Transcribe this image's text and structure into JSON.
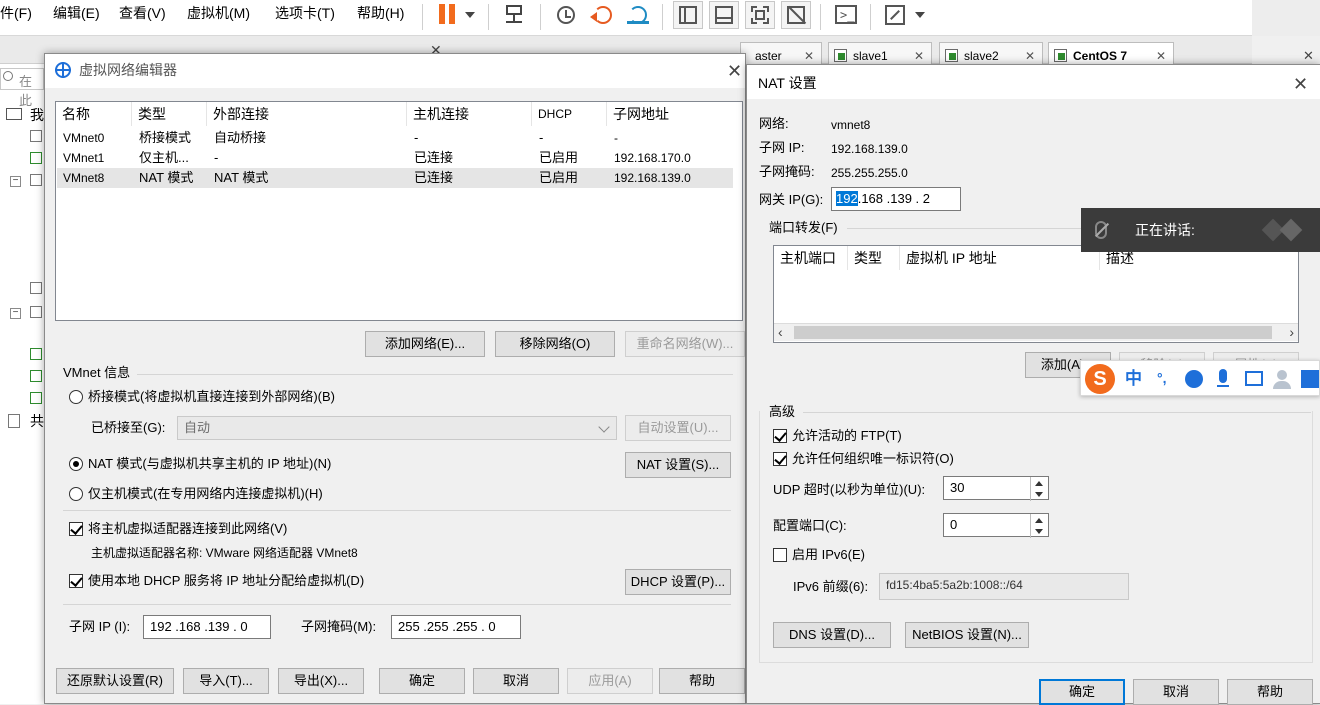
{
  "menubar": {
    "items": [
      "件(F)",
      "编辑(E)",
      "查看(V)",
      "虚拟机(M)",
      "选项卡(T)",
      "帮助(H)"
    ]
  },
  "vm_tabs": {
    "tabs": [
      {
        "label": "aster"
      },
      {
        "label": "slave1"
      },
      {
        "label": "slave2"
      },
      {
        "label": "CentOS 7"
      }
    ]
  },
  "left_pane": {
    "search_placeholder": "在此",
    "tree_labels": [
      "我",
      "共"
    ]
  },
  "vne": {
    "title": "虚拟网络编辑器",
    "columns": [
      "名称",
      "类型",
      "外部连接",
      "主机连接",
      "DHCP",
      "子网地址"
    ],
    "rows": [
      {
        "name": "VMnet0",
        "type": "桥接模式",
        "external": "自动桥接",
        "host": "-",
        "dhcp": "-",
        "subnet": "-"
      },
      {
        "name": "VMnet1",
        "type": "仅主机...",
        "external": "-",
        "host": "已连接",
        "dhcp": "已启用",
        "subnet": "192.168.170.0"
      },
      {
        "name": "VMnet8",
        "type": "NAT 模式",
        "external": "NAT 模式",
        "host": "已连接",
        "dhcp": "已启用",
        "subnet": "192.168.139.0"
      }
    ],
    "btn_add_network": "添加网络(E)...",
    "btn_remove_network": "移除网络(O)",
    "btn_rename_network": "重命名网络(W)...",
    "info_title": "VMnet 信息",
    "radio_bridge": "桥接模式(将虚拟机直接连接到外部网络)(B)",
    "bridge_to_label": "已桥接至(G):",
    "bridge_to_value": "自动",
    "btn_auto_settings": "自动设置(U)...",
    "radio_nat": "NAT 模式(与虚拟机共享主机的 IP 地址)(N)",
    "btn_nat_settings": "NAT 设置(S)...",
    "radio_hostonly": "仅主机模式(在专用网络内连接虚拟机)(H)",
    "check_adapter": "将主机虚拟适配器连接到此网络(V)",
    "adapter_name": "主机虚拟适配器名称: VMware 网络适配器 VMnet8",
    "check_dhcp": "使用本地 DHCP 服务将 IP 地址分配给虚拟机(D)",
    "btn_dhcp_settings": "DHCP 设置(P)...",
    "subnet_ip_label": "子网 IP (I):",
    "subnet_ip_value": "192 .168 .139 .  0",
    "subnet_mask_label": "子网掩码(M):",
    "subnet_mask_value": "255 .255 .255 .  0",
    "btn_restore": "还原默认设置(R)",
    "btn_import": "导入(T)...",
    "btn_export": "导出(X)...",
    "btn_ok": "确定",
    "btn_cancel": "取消",
    "btn_apply": "应用(A)",
    "btn_help": "帮助"
  },
  "nat": {
    "title": "NAT 设置",
    "network_label": "网络:",
    "network_value": "vmnet8",
    "subnet_ip_label": "子网 IP:",
    "subnet_ip_value": "192.168.139.0",
    "subnet_mask_label": "子网掩码:",
    "subnet_mask_value": "255.255.255.0",
    "gateway_label": "网关 IP(G):",
    "gateway_selected": "192",
    "gateway_rest": ".168 .139 .  2",
    "port_forward_title": "端口转发(F)",
    "pf_columns": [
      "主机端口",
      "类型",
      "虚拟机 IP 地址",
      "描述"
    ],
    "btn_add": "添加(A)...",
    "btn_remove": "移除(V)",
    "btn_properties": "属性(P)",
    "advanced_title": "高级",
    "check_ftp": "允许活动的 FTP(T)",
    "check_oui": "允许任何组织唯一标识符(O)",
    "udp_label": "UDP 超时(以秒为单位)(U):",
    "udp_value": "30",
    "config_port_label": "配置端口(C):",
    "config_port_value": "0",
    "check_ipv6": "启用 IPv6(E)",
    "ipv6_prefix_label": "IPv6 前缀(6):",
    "ipv6_prefix_value": "fd15:4ba5:5a2b:1008::/64",
    "btn_dns": "DNS 设置(D)...",
    "btn_netbios": "NetBIOS 设置(N)...",
    "btn_ok": "确定",
    "btn_cancel": "取消",
    "btn_help": "帮助"
  },
  "speaking_popup": {
    "text": "正在讲话:"
  },
  "ime": {
    "lang": "中",
    "punct": "°,"
  },
  "colors": {
    "accent": "#0078d7",
    "pause_orange": "#f26b1d",
    "ime_orange": "#f26b1d",
    "ime_blue": "#1e6fd9"
  }
}
